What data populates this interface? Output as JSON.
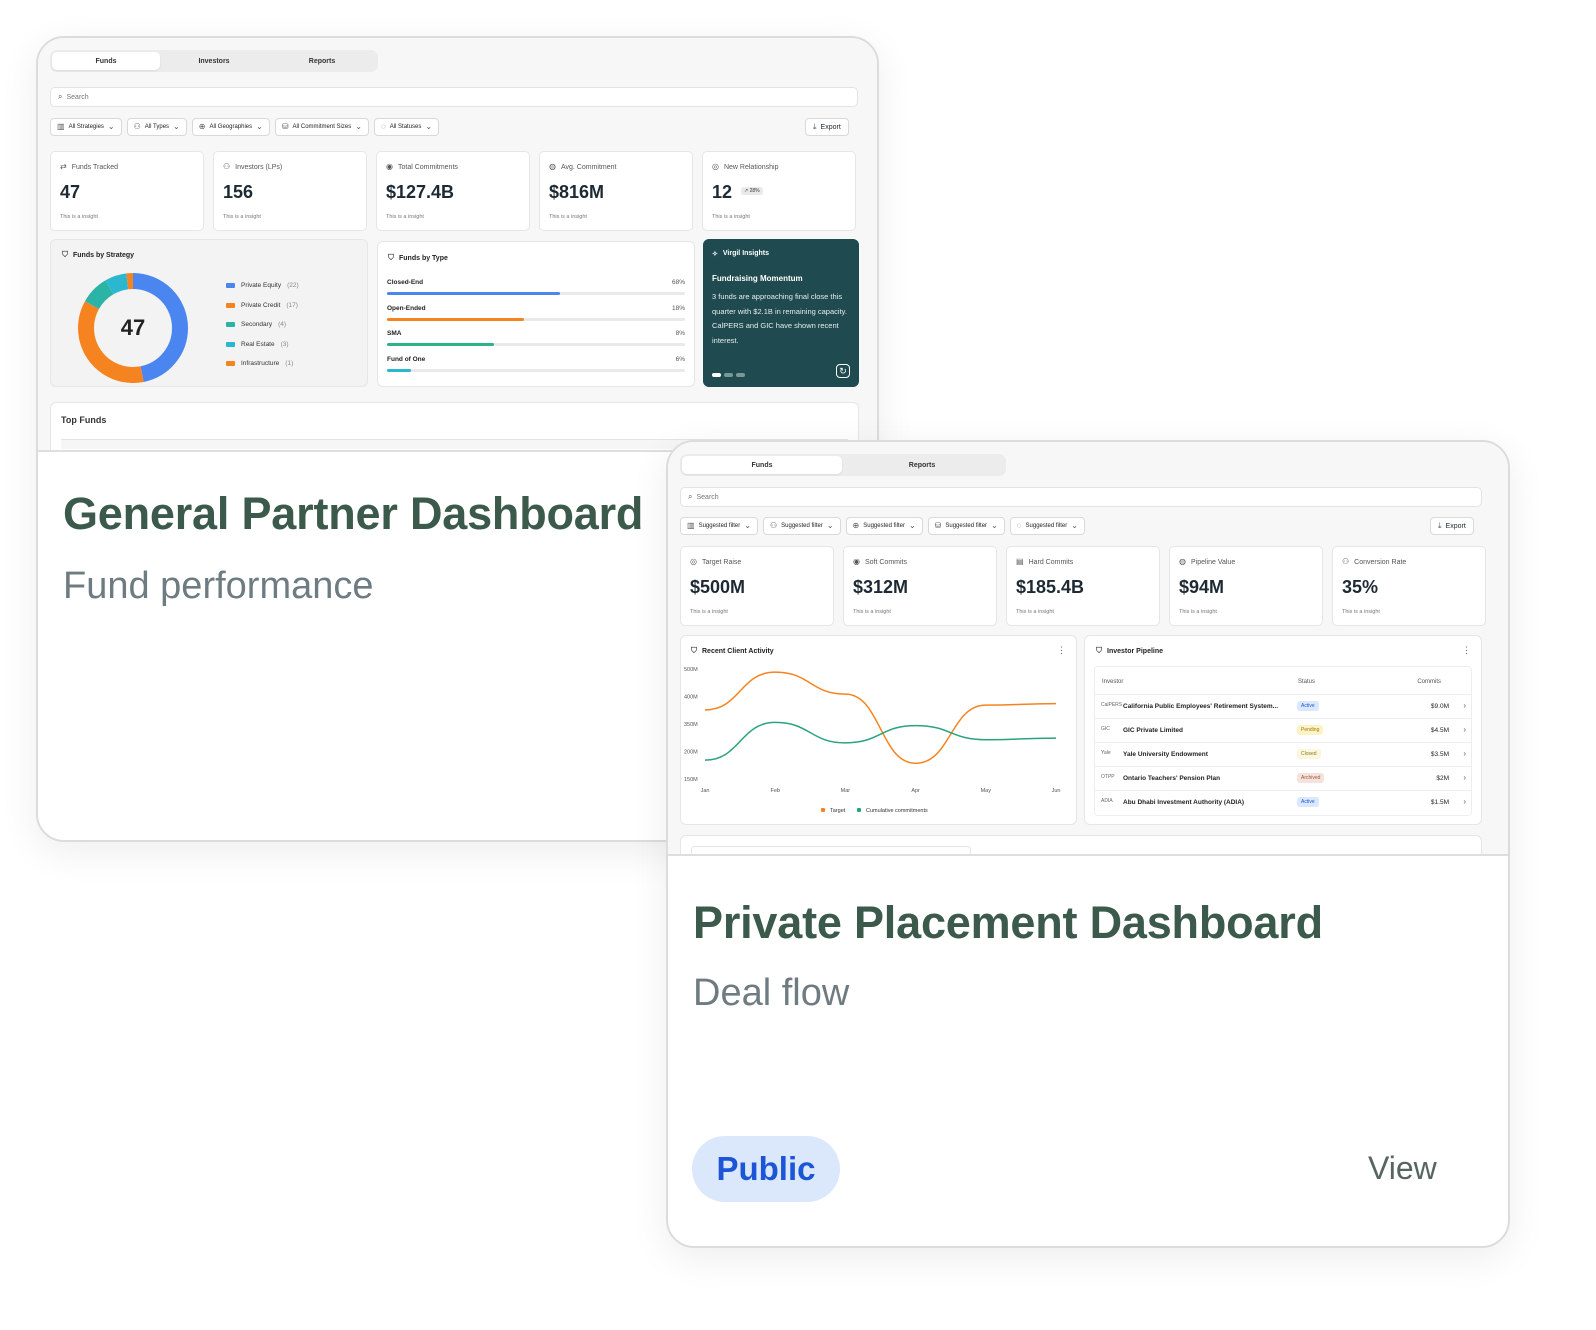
{
  "gp": {
    "tabs": [
      "Funds",
      "Investors",
      "Reports"
    ],
    "search_placeholder": "Search",
    "filters": [
      "All Strategies",
      "All Types",
      "All Geographies",
      "All Commitment Sizes",
      "All Statuses"
    ],
    "export_label": "Export",
    "kpis": [
      {
        "label": "Funds Tracked",
        "value": "47",
        "insight": "This is a insight"
      },
      {
        "label": "Investors (LPs)",
        "value": "156",
        "insight": "This is a insight"
      },
      {
        "label": "Total Commitments",
        "value": "$127.4B",
        "insight": "This is a insight"
      },
      {
        "label": "Avg. Commitment",
        "value": "$816M",
        "insight": "This is a insight"
      },
      {
        "label": "New Relationship",
        "value": "12",
        "badge": "↗ 28%",
        "insight": "This is a insight"
      }
    ],
    "strategy": {
      "title": "Funds by Strategy",
      "total": "47",
      "items": [
        {
          "name": "Private Equity",
          "count": "(22)",
          "value": 22,
          "color": "#4a85f0"
        },
        {
          "name": "Private Credit",
          "count": "(17)",
          "value": 17,
          "color": "#f5831f"
        },
        {
          "name": "Secondary",
          "count": "(4)",
          "value": 4,
          "color": "#2bb3a6"
        },
        {
          "name": "Real Estate",
          "count": "(3)",
          "value": 3,
          "color": "#2bb7d0"
        },
        {
          "name": "Infrastructure",
          "count": "(1)",
          "value": 1,
          "color": "#f5831f"
        }
      ]
    },
    "types": {
      "title": "Funds by Type",
      "items": [
        {
          "name": "Closed-End",
          "pct": "68%",
          "fill": 0.58,
          "color": "#4a85f0"
        },
        {
          "name": "Open-Ended",
          "pct": "18%",
          "fill": 0.46,
          "color": "#f5831f"
        },
        {
          "name": "SMA",
          "pct": "8%",
          "fill": 0.36,
          "color": "#2bb38a"
        },
        {
          "name": "Fund of One",
          "pct": "6%",
          "fill": 0.08,
          "color": "#2bb7d0"
        }
      ]
    },
    "insights": {
      "title": "Virgil Insights",
      "heading": "Fundraising Momentum",
      "body": "3 funds are approaching final close this quarter with $2.1B in remaining capacity. CalPERS and GIC have shown recent interest."
    },
    "top_funds_title": "Top Funds",
    "card_title": "General Partner Dashboard",
    "card_subtitle": "Fund performance"
  },
  "pp": {
    "tabs": [
      "Funds",
      "Reports"
    ],
    "search_placeholder": "Search",
    "filters": [
      "Suggested filter",
      "Suggested filter",
      "Suggested filter",
      "Suggested filter",
      "Suggested filter"
    ],
    "export_label": "Export",
    "kpis": [
      {
        "label": "Target Raise",
        "value": "$500M",
        "insight": "This is a insight"
      },
      {
        "label": "Soft Commits",
        "value": "$312M",
        "insight": "This is a insight"
      },
      {
        "label": "Hard Commits",
        "value": "$185.4B",
        "insight": "This is a insight"
      },
      {
        "label": "Pipeline Value",
        "value": "$94M",
        "insight": "This is a insight"
      },
      {
        "label": "Conversion Rate",
        "value": "35%",
        "insight": "This is a insight"
      }
    ],
    "activity_title": "Recent Client Activity",
    "pipeline": {
      "title": "Investor Pipeline",
      "headers": {
        "investor": "Investor",
        "status": "Status",
        "commits": "Commits"
      },
      "rows": [
        {
          "logo": "CalPERS",
          "name": "California Public Employees' Retirement System...",
          "status": "Active",
          "commits": "$9.0M"
        },
        {
          "logo": "GIC",
          "name": "GIC Private Limited",
          "status": "Pending",
          "commits": "$4.5M"
        },
        {
          "logo": "Yale",
          "name": "Yale University Endowment",
          "status": "Closed",
          "commits": "$3.5M"
        },
        {
          "logo": "OTPP",
          "name": "Ontario Teachers' Pension Plan",
          "status": "Archived",
          "commits": "$2M"
        },
        {
          "logo": "ADIA",
          "name": "Abu Dhabi Investment Authority (ADIA)",
          "status": "Active",
          "commits": "$1.5M"
        }
      ]
    },
    "card_title": "Private Placement Dashboard",
    "card_subtitle": "Deal flow",
    "badge": "Public",
    "view_label": "View"
  },
  "status_colors": {
    "Active": {
      "bg": "#dbe8fb",
      "fg": "#1c56d6"
    },
    "Pending": {
      "bg": "#fcf3c8",
      "fg": "#a07a00"
    },
    "Closed": {
      "bg": "#fbf6dc",
      "fg": "#8a7a30"
    },
    "Archived": {
      "bg": "#f3e3dc",
      "fg": "#a0553a"
    }
  },
  "chart_data": {
    "type": "line",
    "categories": [
      "Jan",
      "Feb",
      "Mar",
      "Apr",
      "May",
      "Jun"
    ],
    "ylabels": [
      "500M",
      "400M",
      "350M",
      "200M",
      "150M"
    ],
    "series": [
      {
        "name": "Target",
        "color": "#f5831f",
        "values": [
          370,
          490,
          420,
          200,
          385,
          390
        ]
      },
      {
        "name": "Cumulative commitments",
        "color": "#2aa37e",
        "values": [
          210,
          330,
          265,
          320,
          275,
          280
        ]
      }
    ]
  }
}
